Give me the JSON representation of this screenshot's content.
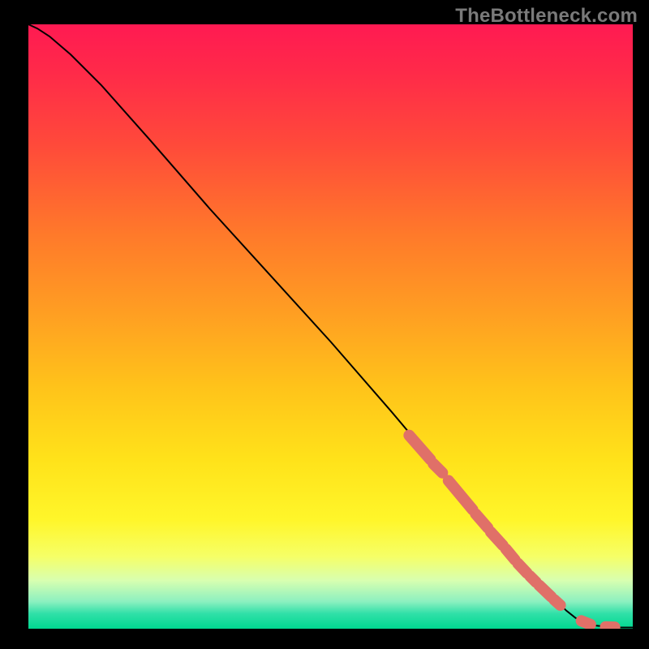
{
  "watermark": "TheBottleneck.com",
  "gradient": {
    "stops": [
      {
        "offset": 0.0,
        "color": "#ff1a52"
      },
      {
        "offset": 0.08,
        "color": "#ff2a49"
      },
      {
        "offset": 0.2,
        "color": "#ff4a3a"
      },
      {
        "offset": 0.35,
        "color": "#ff7a2a"
      },
      {
        "offset": 0.48,
        "color": "#ff9f22"
      },
      {
        "offset": 0.6,
        "color": "#ffc31a"
      },
      {
        "offset": 0.72,
        "color": "#ffe21a"
      },
      {
        "offset": 0.82,
        "color": "#fff62a"
      },
      {
        "offset": 0.88,
        "color": "#f6ff66"
      },
      {
        "offset": 0.92,
        "color": "#d8ffb0"
      },
      {
        "offset": 0.955,
        "color": "#8cf0c0"
      },
      {
        "offset": 0.975,
        "color": "#30e0a8"
      },
      {
        "offset": 1.0,
        "color": "#00d890"
      }
    ]
  },
  "chart_data": {
    "type": "line",
    "xlim": [
      0,
      100
    ],
    "ylim": [
      0,
      100
    ],
    "xlabel": "",
    "ylabel": "",
    "title": "",
    "series": [
      {
        "name": "curve",
        "x": [
          0.0,
          1.5,
          3.5,
          7.0,
          12.0,
          20.0,
          30.0,
          40.0,
          50.0,
          60.0,
          68.0,
          75.0,
          80.0,
          84.0,
          87.0,
          89.0,
          90.5,
          92.0,
          94.0,
          96.0,
          98.0,
          100.0
        ],
        "y": [
          100.0,
          99.3,
          98.0,
          95.0,
          90.0,
          81.0,
          69.5,
          58.5,
          47.5,
          36.0,
          26.5,
          18.0,
          12.0,
          8.0,
          5.0,
          3.0,
          1.8,
          1.0,
          0.5,
          0.3,
          0.2,
          0.2
        ]
      }
    ],
    "beads": {
      "name": "highlighted-segments",
      "color": "#e07068",
      "segments": [
        {
          "x0": 63.0,
          "y0": 32.0,
          "x1": 66.5,
          "y1": 28.0
        },
        {
          "x0": 67.0,
          "y0": 27.3,
          "x1": 68.5,
          "y1": 25.8
        },
        {
          "x0": 69.5,
          "y0": 24.5,
          "x1": 73.5,
          "y1": 19.7
        },
        {
          "x0": 74.0,
          "y0": 19.0,
          "x1": 76.0,
          "y1": 16.7
        },
        {
          "x0": 76.5,
          "y0": 16.0,
          "x1": 78.5,
          "y1": 13.8
        },
        {
          "x0": 79.0,
          "y0": 13.2,
          "x1": 80.5,
          "y1": 11.4
        },
        {
          "x0": 81.0,
          "y0": 10.8,
          "x1": 82.5,
          "y1": 9.2
        },
        {
          "x0": 83.0,
          "y0": 8.7,
          "x1": 84.0,
          "y1": 7.7
        },
        {
          "x0": 84.5,
          "y0": 7.2,
          "x1": 86.5,
          "y1": 5.3
        },
        {
          "x0": 87.0,
          "y0": 4.8,
          "x1": 88.0,
          "y1": 3.9
        },
        {
          "x0": 91.5,
          "y0": 1.3,
          "x1": 93.0,
          "y1": 0.7
        },
        {
          "x0": 95.5,
          "y0": 0.3,
          "x1": 97.0,
          "y1": 0.25
        }
      ]
    }
  }
}
